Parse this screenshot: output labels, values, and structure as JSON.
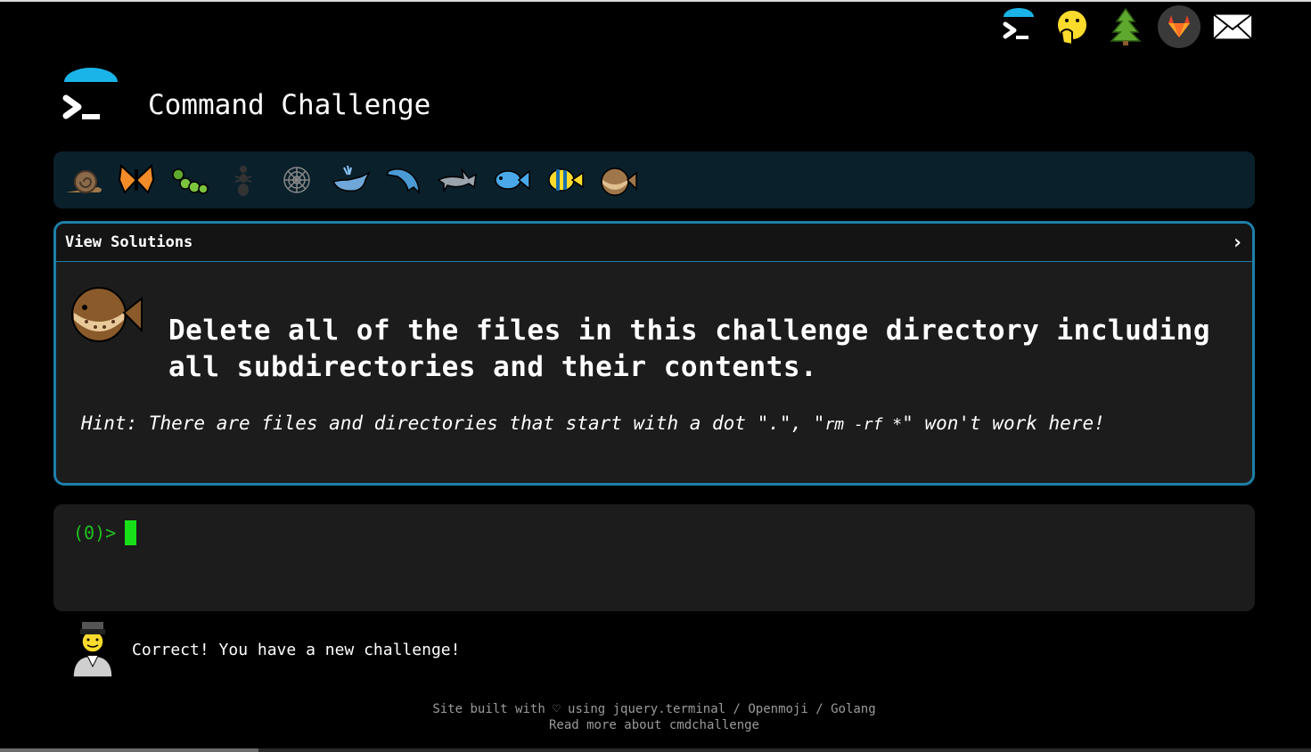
{
  "header": {
    "title": "Command Challenge"
  },
  "top_icons": [
    "cmdchallenge-logo-icon",
    "face-with-hand-over-mouth-icon",
    "tree-icon",
    "gitlab-icon",
    "envelope-icon"
  ],
  "levels": [
    "snail-icon",
    "butterfly-icon",
    "caterpillar-icon",
    "ant-icon",
    "spider-web-icon",
    "whale-icon",
    "dolphin-icon",
    "shark-icon",
    "fish-icon",
    "tropical-fish-icon",
    "blowfish-icon"
  ],
  "panel": {
    "header_label": "View Solutions",
    "chevron": "›",
    "challenge_line1": "Delete all of the files in this challenge directory including",
    "challenge_line2": "all subdirectories and their contents.",
    "hint_prefix": "Hint: There are files and directories that start with a dot \".\", \"",
    "hint_code": "rm -rf *",
    "hint_suffix": "\" won't work here!"
  },
  "terminal": {
    "prompt": "(0)>"
  },
  "status": {
    "message": "Correct! You have a new challenge!"
  },
  "footer": {
    "line1_prefix": "Site built with ♡ using ",
    "link_jquery": "jquery.terminal",
    "sep1": " / ",
    "link_openmoji": "Openmoji",
    "sep2": " / ",
    "link_golang": "Golang",
    "line2": "Read more about cmdchallenge"
  },
  "colors": {
    "accent": "#1e7fa8",
    "prompt": "#1fc21f",
    "cursor": "#18e018",
    "panel_bg": "#1c1c1c",
    "level_bar_bg": "#0a202b"
  }
}
